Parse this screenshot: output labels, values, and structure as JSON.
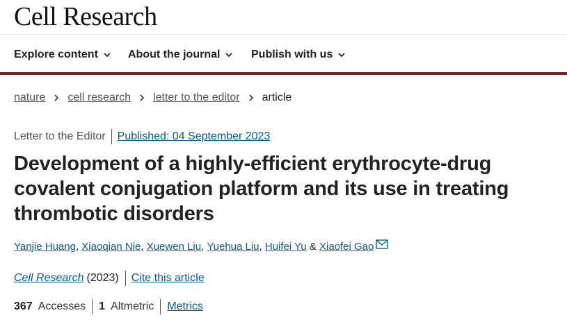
{
  "header": {
    "logo_text": "Cell Research"
  },
  "nav": {
    "items": [
      {
        "label": "Explore content"
      },
      {
        "label": "About the journal"
      },
      {
        "label": "Publish with us"
      }
    ]
  },
  "breadcrumb": {
    "items": [
      "nature",
      "cell research",
      "letter to the editor",
      "article"
    ]
  },
  "article": {
    "type": "Letter to the Editor",
    "published": "Published: 04 September 2023",
    "title": "Development of a highly-efficient erythrocyte-drug covalent conjugation platform and its use in treating thrombotic disorders",
    "authors": [
      "Yanjie Huang",
      "Xiaoqian Nie",
      "Xuewen Liu",
      "Yuehua Liu",
      "Huifei Yu",
      "Xiaofei Gao"
    ],
    "author_separator": ", ",
    "author_last_joiner": " & ",
    "journal": "Cell Research",
    "year": "(2023)",
    "cite_label": "Cite this article",
    "accesses_count": "367",
    "accesses_label": "Accesses",
    "altmetric_count": "1",
    "altmetric_label": "Altmetric",
    "metrics_label": "Metrics"
  },
  "colors": {
    "brand_accent": "#7a1e25",
    "link": "#025e8d",
    "text": "#222222"
  },
  "icons": {
    "nav_chevron": "chevron-down-icon",
    "breadcrumb_separator": "chevron-right-icon",
    "corresponding_author": "mail-icon"
  }
}
